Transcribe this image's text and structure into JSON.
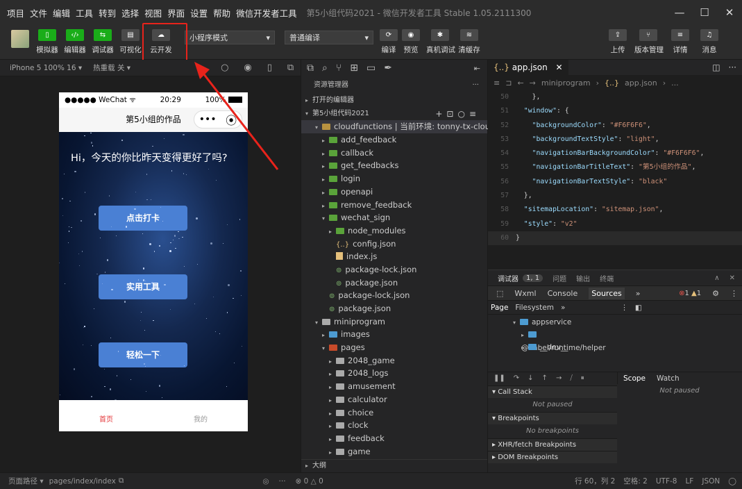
{
  "menu": [
    "项目",
    "文件",
    "编辑",
    "工具",
    "转到",
    "选择",
    "视图",
    "界面",
    "设置",
    "帮助",
    "微信开发者工具"
  ],
  "window_title": "第5小组代码2021 - 微信开发者工具 Stable 1.05.2111300",
  "toolbar": {
    "simulator": "模拟器",
    "editor": "编辑器",
    "debugger": "调试器",
    "visual": "可视化",
    "cloud": "云开发",
    "mode_select": "小程序模式",
    "compile_select": "普通编译",
    "compile": "编译",
    "preview": "预览",
    "real_debug": "真机调试",
    "clear_cache": "清缓存",
    "upload": "上传",
    "version": "版本管理",
    "details": "详情",
    "messages": "消息"
  },
  "sim_header": {
    "device": "iPhone 5 100% 16 ▾",
    "hot_reload": "热重载 关 ▾"
  },
  "phone": {
    "carrier": "●●●●● WeChat",
    "time": "20:29",
    "battery": "100%",
    "nav_title": "第5小组的作品",
    "capsule_dots": "•••",
    "greeting": "Hi，今天的你比昨天变得更好了吗?",
    "buttons": [
      "点击打卡",
      "实用工具",
      "轻松一下"
    ],
    "tabs": [
      "首页",
      "我的"
    ]
  },
  "explorer": {
    "title": "资源管理器",
    "open_editors": "打开的编辑器",
    "project": "第5小组代码2021",
    "tree": [
      {
        "label": "cloudfunctions | 当前环境: tonny-tx-cloud",
        "indent": 1,
        "arrow": "▾",
        "icon": "fold"
      },
      {
        "label": "add_feedback",
        "indent": 2,
        "arrow": "▸",
        "icon": "fold g"
      },
      {
        "label": "callback",
        "indent": 2,
        "arrow": "▸",
        "icon": "fold g"
      },
      {
        "label": "get_feedbacks",
        "indent": 2,
        "arrow": "▸",
        "icon": "fold g"
      },
      {
        "label": "login",
        "indent": 2,
        "arrow": "▸",
        "icon": "fold g"
      },
      {
        "label": "openapi",
        "indent": 2,
        "arrow": "▸",
        "icon": "fold g"
      },
      {
        "label": "remove_feedback",
        "indent": 2,
        "arrow": "▸",
        "icon": "fold g"
      },
      {
        "label": "wechat_sign",
        "indent": 2,
        "arrow": "▾",
        "icon": "fold g"
      },
      {
        "label": "node_modules",
        "indent": 3,
        "arrow": "▸",
        "icon": "fold g"
      },
      {
        "label": "config.json",
        "indent": 3,
        "arrow": "",
        "icon": "json"
      },
      {
        "label": "index.js",
        "indent": 3,
        "arrow": "",
        "icon": "js"
      },
      {
        "label": "package-lock.json",
        "indent": 3,
        "arrow": "",
        "icon": "pkg"
      },
      {
        "label": "package.json",
        "indent": 3,
        "arrow": "",
        "icon": "pkg"
      },
      {
        "label": "package-lock.json",
        "indent": 2,
        "arrow": "",
        "icon": "pkg"
      },
      {
        "label": "package.json",
        "indent": 2,
        "arrow": "",
        "icon": "pkg"
      },
      {
        "label": "miniprogram",
        "indent": 1,
        "arrow": "▾",
        "icon": "fold w"
      },
      {
        "label": "images",
        "indent": 2,
        "arrow": "▸",
        "icon": "fold b"
      },
      {
        "label": "pages",
        "indent": 2,
        "arrow": "▾",
        "icon": "fold o"
      },
      {
        "label": "2048_game",
        "indent": 3,
        "arrow": "▸",
        "icon": "fold w"
      },
      {
        "label": "2048_logs",
        "indent": 3,
        "arrow": "▸",
        "icon": "fold w"
      },
      {
        "label": "amusement",
        "indent": 3,
        "arrow": "▸",
        "icon": "fold w"
      },
      {
        "label": "calculator",
        "indent": 3,
        "arrow": "▸",
        "icon": "fold w"
      },
      {
        "label": "choice",
        "indent": 3,
        "arrow": "▸",
        "icon": "fold w"
      },
      {
        "label": "clock",
        "indent": 3,
        "arrow": "▸",
        "icon": "fold w"
      },
      {
        "label": "feedback",
        "indent": 3,
        "arrow": "▸",
        "icon": "fold w"
      },
      {
        "label": "game",
        "indent": 3,
        "arrow": "▸",
        "icon": "fold w"
      }
    ],
    "outline": "大纲"
  },
  "editor": {
    "tab": "app.json",
    "crumb_path": "miniprogram",
    "crumb_file": "app.json",
    "crumb_more": "...",
    "lines": [
      {
        "n": "50",
        "html": [
          [
            "p",
            "    },"
          ]
        ]
      },
      {
        "n": "51",
        "html": [
          [
            "p",
            "  "
          ],
          [
            "k",
            "\"window\""
          ],
          [
            "p",
            ": {"
          ]
        ]
      },
      {
        "n": "52",
        "html": [
          [
            "p",
            "    "
          ],
          [
            "k",
            "\"backgroundColor\""
          ],
          [
            "p",
            ": "
          ],
          [
            "s",
            "\"#F6F6F6\""
          ],
          [
            "p",
            ","
          ]
        ]
      },
      {
        "n": "53",
        "html": [
          [
            "p",
            "    "
          ],
          [
            "k",
            "\"backgroundTextStyle\""
          ],
          [
            "p",
            ": "
          ],
          [
            "s",
            "\"light\""
          ],
          [
            "p",
            ","
          ]
        ]
      },
      {
        "n": "54",
        "html": [
          [
            "p",
            "    "
          ],
          [
            "k",
            "\"navigationBarBackgroundColor\""
          ],
          [
            "p",
            ": "
          ],
          [
            "s",
            "\"#F6F6F6\""
          ],
          [
            "p",
            ","
          ]
        ]
      },
      {
        "n": "55",
        "html": [
          [
            "p",
            "    "
          ],
          [
            "k",
            "\"navigationBarTitleText\""
          ],
          [
            "p",
            ": "
          ],
          [
            "s",
            "\"第5小组的作品\""
          ],
          [
            "p",
            ","
          ]
        ]
      },
      {
        "n": "56",
        "html": [
          [
            "p",
            "    "
          ],
          [
            "k",
            "\"navigationBarTextStyle\""
          ],
          [
            "p",
            ": "
          ],
          [
            "s",
            "\"black\""
          ]
        ]
      },
      {
        "n": "57",
        "html": [
          [
            "p",
            "  },"
          ]
        ]
      },
      {
        "n": "58",
        "html": [
          [
            "p",
            "  "
          ],
          [
            "k",
            "\"sitemapLocation\""
          ],
          [
            "p",
            ": "
          ],
          [
            "s",
            "\"sitemap.json\""
          ],
          [
            "p",
            ","
          ]
        ]
      },
      {
        "n": "59",
        "html": [
          [
            "p",
            "  "
          ],
          [
            "k",
            "\"style\""
          ],
          [
            "p",
            ": "
          ],
          [
            "s",
            "\"v2\""
          ]
        ]
      },
      {
        "n": "60",
        "html": [
          [
            "p",
            "}"
          ]
        ]
      }
    ]
  },
  "debugger": {
    "title": "调试器",
    "badge": "1, 1",
    "issues": "问题",
    "output": "输出",
    "terminal": "终端",
    "tabs": [
      "Wxml",
      "Console",
      "Sources"
    ],
    "more": "»",
    "errors": "1",
    "warnings": "1",
    "sub_tabs": [
      "Page",
      "Filesystem"
    ],
    "tree": [
      "appservice",
      "@babel/runtime/helper",
      "__dev__"
    ],
    "call_stack": "Call Stack",
    "not_paused": "Not paused",
    "breakpoints": "Breakpoints",
    "no_breakpoints": "No breakpoints",
    "xhr": "XHR/fetch Breakpoints",
    "dom": "DOM Breakpoints",
    "scope": "Scope",
    "watch": "Watch",
    "scope_msg": "Not paused"
  },
  "statusbar": {
    "path_label": "页面路径 ▾",
    "path": "pages/index/index",
    "problems": "⊗ 0 △ 0",
    "position": "行 60，列 2",
    "spaces": "空格: 2",
    "encoding": "UTF-8",
    "eol": "LF",
    "lang": "JSON"
  },
  "colors": {
    "accent_red": "#e8231b",
    "wechat_green": "#1aad19",
    "button_blue": "#4a80d4"
  }
}
